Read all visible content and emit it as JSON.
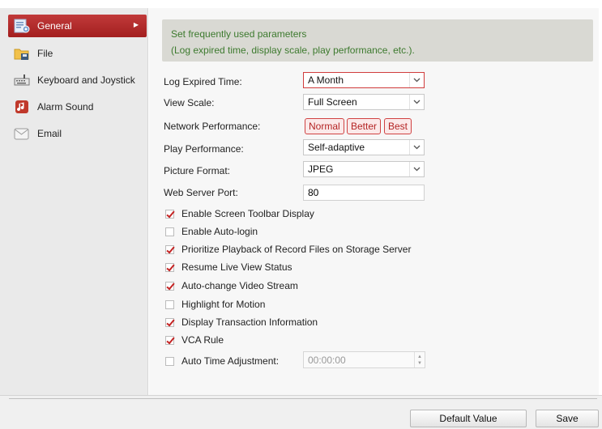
{
  "sidebar": {
    "items": [
      {
        "label": "General",
        "icon": "general-settings-icon",
        "active": true
      },
      {
        "label": "File",
        "icon": "folder-icon"
      },
      {
        "label": "Keyboard and Joystick",
        "icon": "keyboard-icon"
      },
      {
        "label": "Alarm Sound",
        "icon": "alarm-sound-icon"
      },
      {
        "label": "Email",
        "icon": "email-icon"
      }
    ]
  },
  "banner": {
    "line1": "Set frequently used parameters",
    "line2": "(Log expired time, display scale, play performance, etc.)."
  },
  "fields": {
    "log_expired_label": "Log Expired Time:",
    "log_expired_value": "A Month",
    "view_scale_label": "View Scale:",
    "view_scale_value": "Full Screen",
    "network_perf_label": "Network Performance:",
    "network_perf_options": [
      "Normal",
      "Better",
      "Best"
    ],
    "play_perf_label": "Play Performance:",
    "play_perf_value": "Self-adaptive",
    "picture_format_label": "Picture Format:",
    "picture_format_value": "JPEG",
    "web_port_label": "Web Server Port:",
    "web_port_value": "80"
  },
  "checkboxes": [
    {
      "label": "Enable Screen Toolbar Display",
      "checked": true
    },
    {
      "label": "Enable Auto-login",
      "checked": false
    },
    {
      "label": "Prioritize Playback of Record Files on Storage Server",
      "checked": true
    },
    {
      "label": "Resume Live View Status",
      "checked": true
    },
    {
      "label": "Auto-change Video Stream",
      "checked": true
    },
    {
      "label": "Highlight for Motion",
      "checked": false
    },
    {
      "label": "Display Transaction Information",
      "checked": true
    },
    {
      "label": "VCA Rule",
      "checked": true
    },
    {
      "label": "Auto Time Adjustment:",
      "checked": false
    }
  ],
  "auto_time_value": "00:00:00",
  "buttons": {
    "default_value": "Default Value",
    "save": "Save"
  },
  "colors": {
    "accent": "#b52a2a",
    "banner_text": "#3d7a2e"
  }
}
